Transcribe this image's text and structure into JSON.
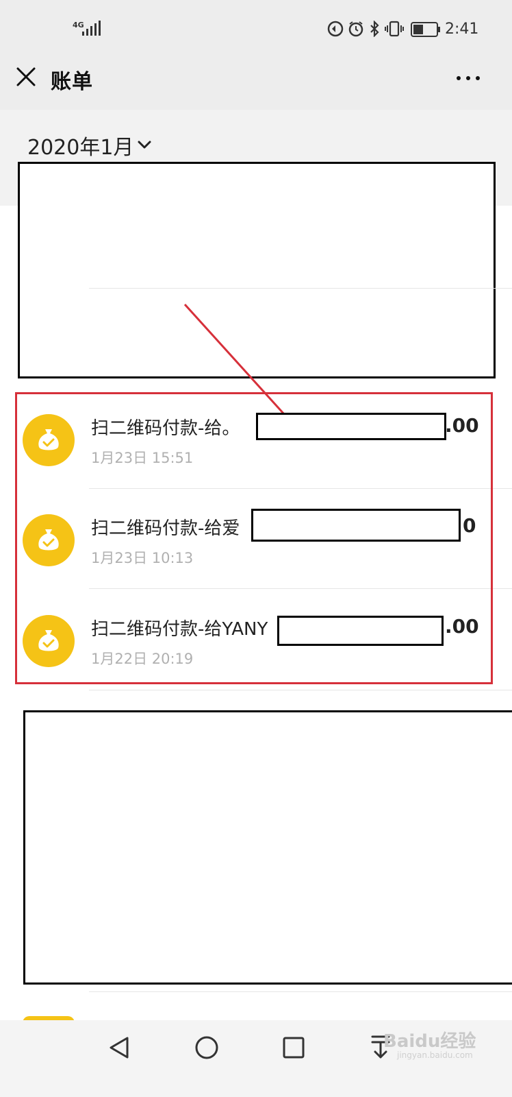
{
  "status_bar": {
    "network": "4G",
    "time": "2:41"
  },
  "header": {
    "title": "账单",
    "close_icon": "close-icon",
    "more_icon": "more-icon"
  },
  "month_selector": {
    "label": "2020年1月"
  },
  "transactions": [
    {
      "title": "扫二维码付款-给。",
      "amount": ".00",
      "time": "1月23日 15:51",
      "icon": "money-bag-check-icon"
    },
    {
      "title": "扫二维码付款-给爱",
      "amount": "0",
      "time": "1月23日 10:13",
      "icon": "money-bag-check-icon"
    },
    {
      "title": "扫二维码付款-给YANY",
      "amount": ".00",
      "time": "1月22日 20:19",
      "icon": "money-bag-check-icon"
    }
  ],
  "bottom_nav": {
    "back": "back-triangle-icon",
    "home": "home-circle-icon",
    "recents": "recents-square-icon",
    "notifications": "pull-down-icon"
  },
  "watermark": {
    "brand": "Baidu经验",
    "url": "jingyan.baidu.com"
  },
  "colors": {
    "icon_bg": "#f5c316",
    "highlight": "#d6303a",
    "header_bg": "#ededed"
  }
}
